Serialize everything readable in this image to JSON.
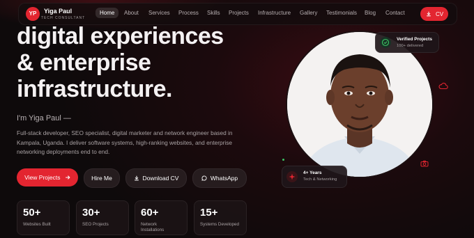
{
  "brand": {
    "initials": "YP",
    "name": "Yiga Paul",
    "tagline": "TECH CONSULTANT"
  },
  "nav": {
    "items": [
      {
        "label": "Home",
        "active": true
      },
      {
        "label": "About"
      },
      {
        "label": "Services"
      },
      {
        "label": "Process"
      },
      {
        "label": "Skills"
      },
      {
        "label": "Projects"
      },
      {
        "label": "Infrastructure"
      },
      {
        "label": "Gallery"
      },
      {
        "label": "Testimonials"
      },
      {
        "label": "Blog"
      },
      {
        "label": "Contact"
      }
    ],
    "cv_label": "CV"
  },
  "hero": {
    "headline": [
      "digital experiences",
      "& enterprise",
      "infrastructure."
    ],
    "intro": "I'm Yiga Paul —",
    "description": "Full-stack developer, SEO specialist, digital marketer and network engineer based in Kampala, Uganda. I deliver software systems, high-ranking websites, and enterprise networking deployments end to end."
  },
  "buttons": {
    "view_projects": "View Projects",
    "hire_me": "Hire Me",
    "download_cv": "Download CV",
    "whatsapp": "WhatsApp"
  },
  "stats": [
    {
      "value": "50+",
      "label": "Websites Built"
    },
    {
      "value": "30+",
      "label": "SEO Projects"
    },
    {
      "value": "60+",
      "label": "Network Installations"
    },
    {
      "value": "15+",
      "label": "Systems Developed"
    }
  ],
  "badges": {
    "verified": {
      "title": "Verified Projects",
      "subtitle": "100+ delivered"
    },
    "years": {
      "title": "4+ Years",
      "subtitle": "Tech & Networking"
    }
  },
  "colors": {
    "accent": "#e32530",
    "background": "#140b0d",
    "success": "#3cc463"
  },
  "icons": [
    "arrow-right-icon",
    "download-icon",
    "chat-icon",
    "check-icon",
    "cloud-icon",
    "camera-icon",
    "sparkle-icon"
  ]
}
